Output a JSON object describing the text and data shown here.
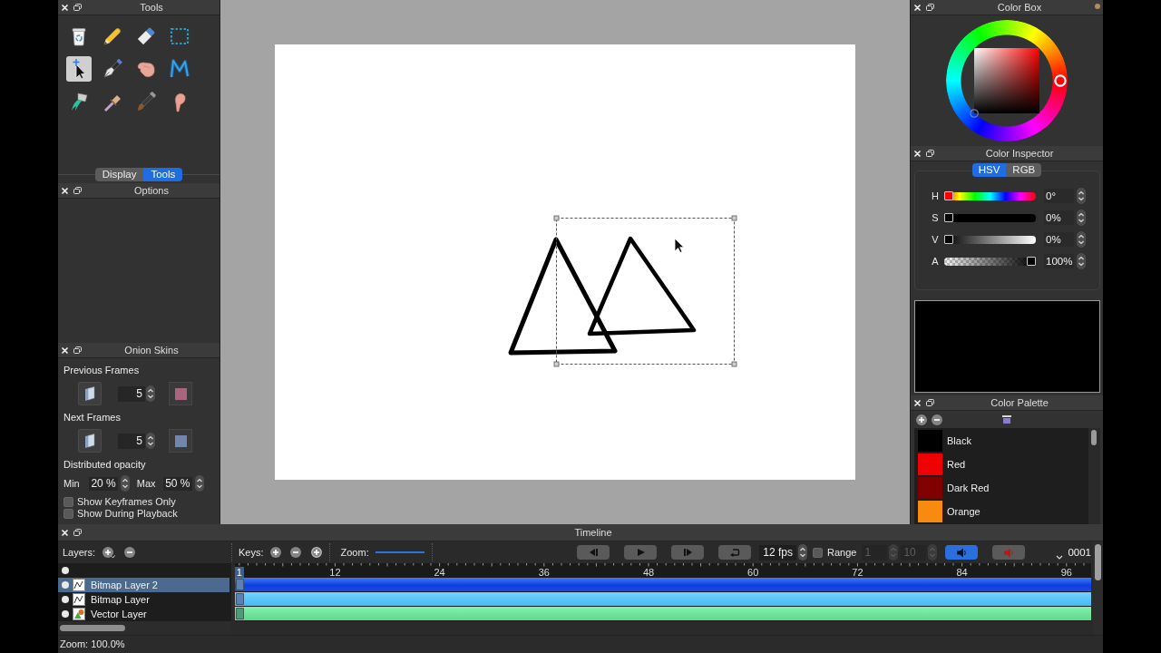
{
  "tools_panel": {
    "title": "Tools",
    "tools": [
      {
        "kind": "clear",
        "selected": false
      },
      {
        "kind": "pencil",
        "selected": false
      },
      {
        "kind": "eraser",
        "selected": false
      },
      {
        "kind": "select",
        "selected": false
      },
      {
        "kind": "move",
        "selected": true
      },
      {
        "kind": "pen",
        "selected": false
      },
      {
        "kind": "hand",
        "selected": false
      },
      {
        "kind": "polyline",
        "selected": false
      },
      {
        "kind": "bucket",
        "selected": false
      },
      {
        "kind": "eyedropper",
        "selected": false
      },
      {
        "kind": "brush",
        "selected": false
      },
      {
        "kind": "smudge",
        "selected": false
      }
    ],
    "tabs": [
      {
        "label": "Display",
        "selected": false
      },
      {
        "label": "Tools",
        "selected": true
      }
    ]
  },
  "options_panel": {
    "title": "Options"
  },
  "onion_skins_panel": {
    "title": "Onion Skins",
    "frames": [
      {
        "label": "Previous Frames",
        "count": "5",
        "color": "#a8667e"
      },
      {
        "label": "Next Frames",
        "count": "5",
        "color": "#6e87aa"
      }
    ],
    "opacity": {
      "label": "Distributed opacity",
      "min_label": "Min",
      "min": "20 %",
      "max_label": "Max",
      "max": "50 %"
    },
    "options": [
      {
        "label": "Show Keyframes Only",
        "checked": false
      },
      {
        "label": "Show During Playback",
        "checked": false
      }
    ]
  },
  "color_box": {
    "title": "Color Box"
  },
  "color_inspector": {
    "title": "Color Inspector",
    "modes": [
      {
        "label": "HSV",
        "selected": true
      },
      {
        "label": "RGB",
        "selected": false
      }
    ],
    "sliders": [
      {
        "kind": "hue",
        "label": "H",
        "level": 0,
        "value": "0°"
      },
      {
        "kind": "saturation",
        "label": "S",
        "level": 0,
        "value": "0%"
      },
      {
        "kind": "value",
        "label": "V",
        "level": 0,
        "value": "0%"
      },
      {
        "kind": "alpha",
        "label": "A",
        "level": 1,
        "value": "100%"
      }
    ]
  },
  "color_palette": {
    "title": "Color Palette",
    "colors": [
      {
        "name": "Black",
        "color": "#000000",
        "selected": false
      },
      {
        "name": "Red",
        "color": "#f00000",
        "selected": false
      },
      {
        "name": "Dark Red",
        "color": "#800000",
        "selected": false
      },
      {
        "name": "Orange",
        "color": "#f88a10",
        "selected": false
      }
    ]
  },
  "timeline": {
    "title": "Timeline",
    "layers_label": "Layers:",
    "keys_label": "Keys:",
    "zoom": {
      "label": "Zoom:",
      "level": 1
    },
    "playback": [
      {
        "kind": "previous_frame"
      },
      {
        "kind": "play"
      },
      {
        "kind": "next_frame"
      }
    ],
    "loop": {
      "on": false
    },
    "fps": "12 fps",
    "range": {
      "label": "Range",
      "checked": false,
      "start": "1",
      "end": "10",
      "disabled": true
    },
    "sound_buttons": [
      {
        "kind": "sound",
        "on": true
      },
      {
        "kind": "mute",
        "on": false
      }
    ],
    "frame_counter": "0001",
    "show_all_layers": true,
    "ruler": [
      {
        "label": "1",
        "selected": true
      },
      {
        "label": "12",
        "selected": false
      },
      {
        "label": "24",
        "selected": false
      },
      {
        "label": "36",
        "selected": false
      },
      {
        "label": "48",
        "selected": false
      },
      {
        "label": "60",
        "selected": false
      },
      {
        "label": "72",
        "selected": false
      },
      {
        "label": "84",
        "selected": false
      },
      {
        "label": "96",
        "selected": false
      }
    ],
    "layers": [
      {
        "name": "Bitmap Layer 2",
        "kind": "bitmap",
        "selected": true,
        "visible": true,
        "keyframe": true
      },
      {
        "name": "Bitmap Layer",
        "kind": "bitmap",
        "selected": false,
        "visible": true,
        "keyframe": true
      },
      {
        "name": "Vector Layer",
        "kind": "vector",
        "selected": false,
        "visible": true,
        "keyframe": true
      }
    ]
  },
  "status_bar": {
    "zoom": "Zoom: 100.0%"
  }
}
